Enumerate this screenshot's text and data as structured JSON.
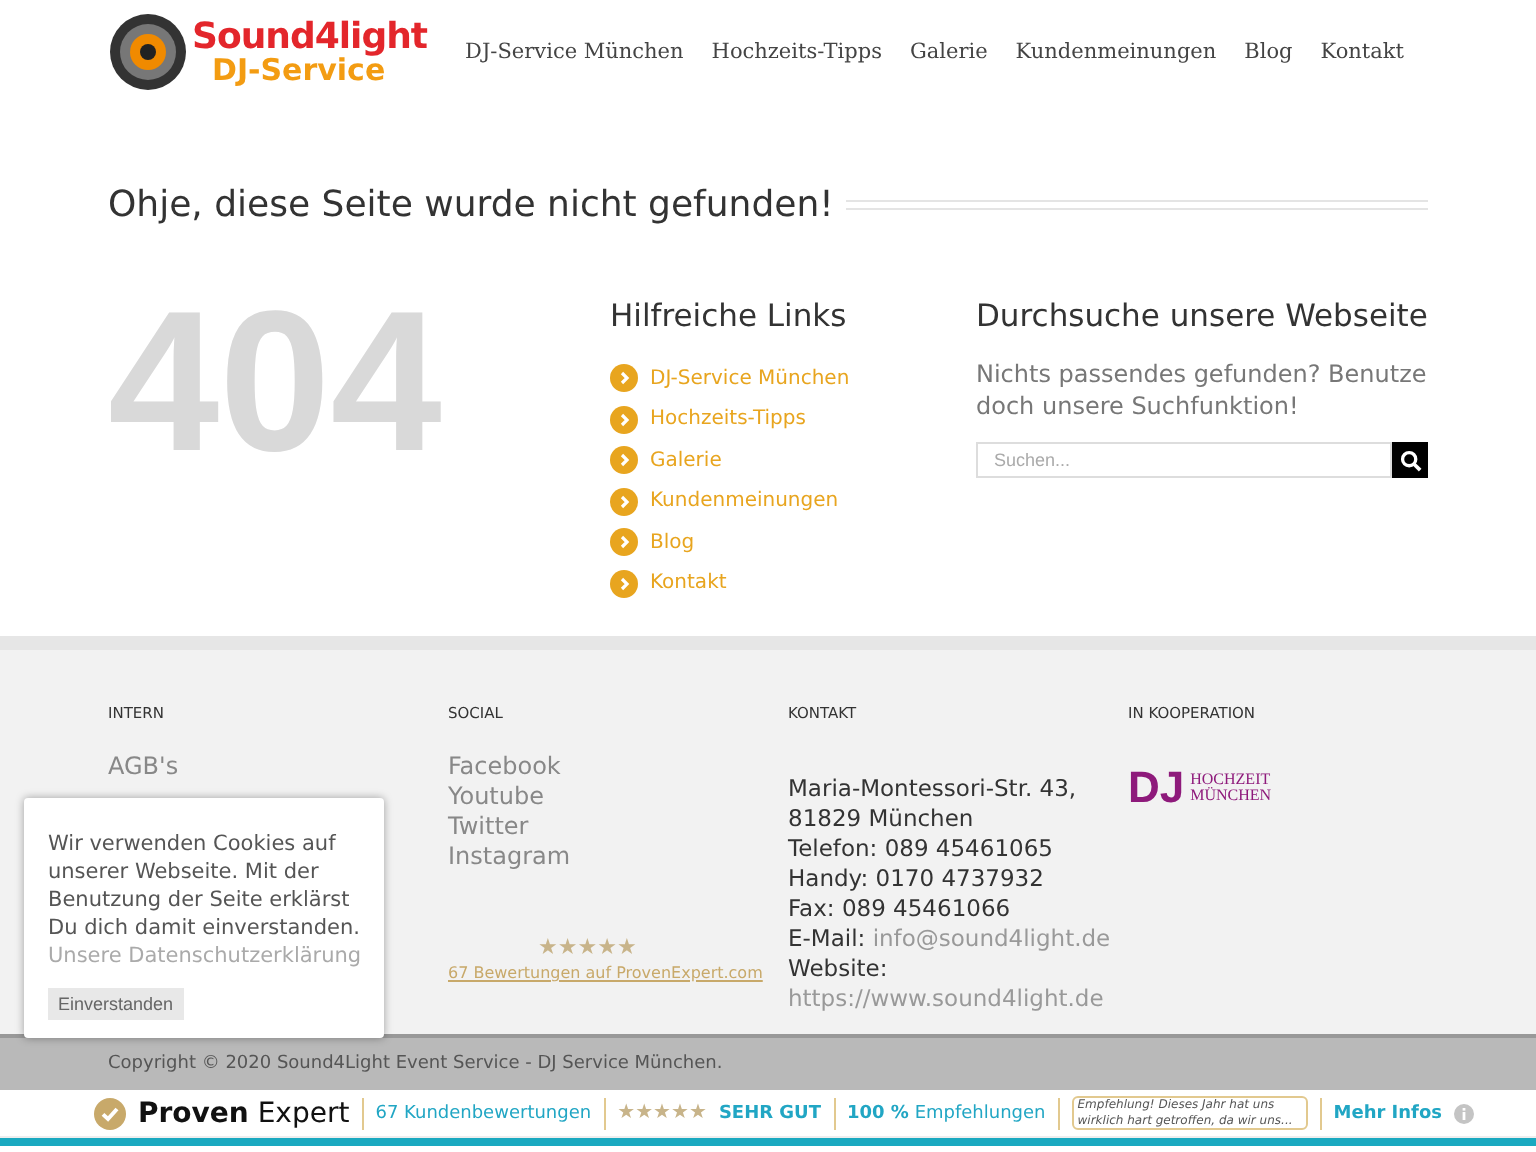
{
  "logo": {
    "line_1": "Sound4light",
    "line_2": "DJ-Service"
  },
  "nav": [
    "DJ-Service München",
    "Hochzeits-Tipps",
    "Galerie",
    "Kundenmeinungen",
    "Blog",
    "Kontakt"
  ],
  "page_title": "Ohje, diese Seite wurde nicht gefunden!",
  "error_code": "404",
  "helpful_links": {
    "title": "Hilfreiche Links",
    "items": [
      "DJ-Service München",
      "Hochzeits-Tipps",
      "Galerie",
      "Kundenmeinungen",
      "Blog",
      "Kontakt"
    ]
  },
  "search": {
    "title": "Durchsuche unsere Webseite",
    "text": "Nichts passendes gefunden? Benutze doch unsere Suchfunktion!",
    "placeholder": "Suchen..."
  },
  "footer": {
    "intern": {
      "title": "INTERN",
      "items": [
        "AGB's"
      ]
    },
    "social": {
      "title": "SOCIAL",
      "items": [
        "Facebook",
        "Youtube",
        "Twitter",
        "Instagram"
      ],
      "stars": 5,
      "reviews_link": "67 Bewertungen auf ProvenExpert.com"
    },
    "contact": {
      "title": "KONTAKT",
      "lines": [
        {
          "kind": "plain",
          "text": "Maria-Montessori-Str. 43,"
        },
        {
          "kind": "plain",
          "text": "81829 München"
        },
        {
          "kind": "plain",
          "text": "Telefon: 089 45461065"
        },
        {
          "kind": "plain",
          "text": "Handy: 0170 4737932"
        },
        {
          "kind": "plain",
          "text": "Fax: 089 45461066"
        },
        {
          "kind": "labeled",
          "label": "E-Mail:",
          "link": "info@sound4light.de"
        },
        {
          "kind": "plain",
          "text": "Website:"
        },
        {
          "kind": "link",
          "text": "https://www.sound4light.de"
        }
      ]
    },
    "cooperation": {
      "title": "IN KOOPERATION",
      "logo_mark": "DJ",
      "logo_line_1": "HOCHZEIT",
      "logo_line_2": "MÜNCHEN"
    }
  },
  "copyright": "Copyright © 2020 Sound4Light Event Service - DJ Service München.",
  "cookie_banner": {
    "text": "Wir verwenden Cookies auf unserer Webseite. Mit der Benutzung der Seite erklärst Du dich damit einverstanden.",
    "link": "Unsere Datenschutzerklärung",
    "button": "Einverstanden"
  },
  "proven_expert_bar": {
    "brand_1": "Proven",
    "brand_2": "Expert",
    "reviews": "67 Kundenbewertungen",
    "stars": 5,
    "rating": "SEHR GUT",
    "recommend_value": "100 %",
    "recommend_label": "Empfehlungen",
    "quote": "Empfehlung! Dieses Jahr hat uns wirklich hart getroffen, da wir uns...",
    "more": "Mehr Infos"
  }
}
